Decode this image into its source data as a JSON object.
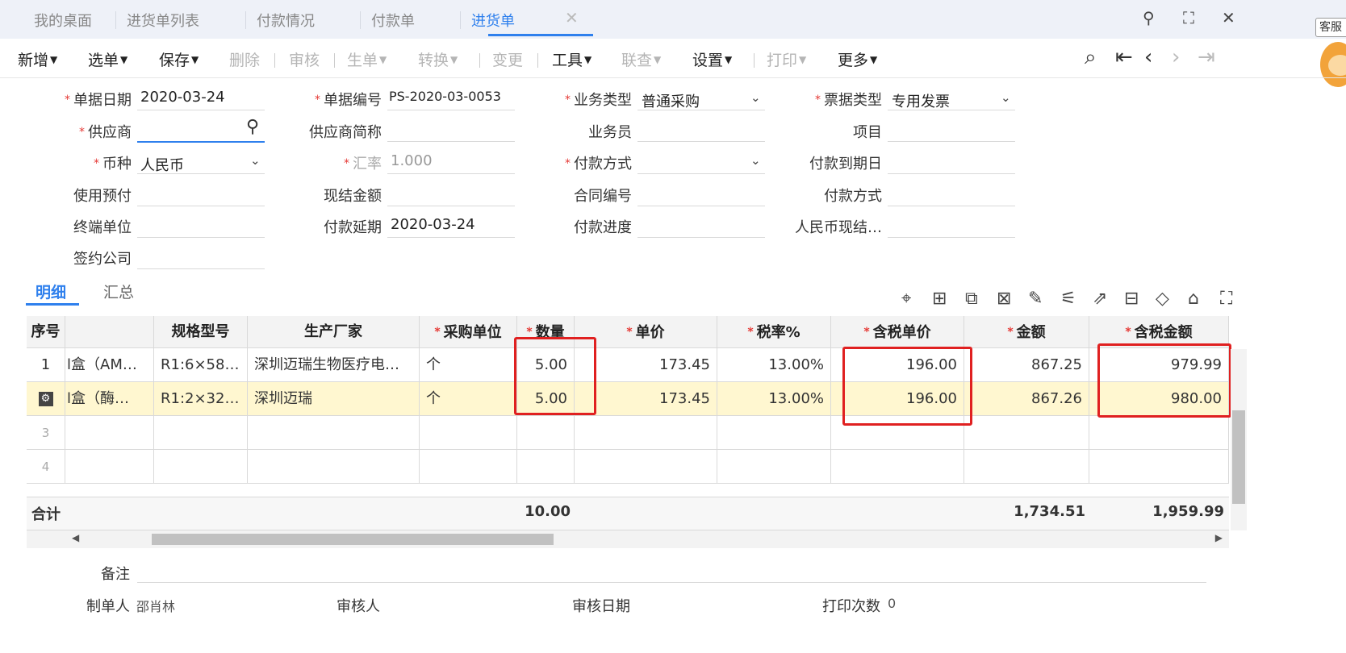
{
  "tabs": {
    "items": [
      {
        "label": "我的桌面"
      },
      {
        "label": "进货单列表"
      },
      {
        "label": "付款情况"
      },
      {
        "label": "付款单"
      },
      {
        "label": "进货单"
      }
    ],
    "close": "✕",
    "kefu": "客服"
  },
  "toolbar": {
    "add": "新增",
    "select": "选单",
    "save": "保存",
    "delete": "删除",
    "audit": "审核",
    "generate": "生单",
    "convert": "转换",
    "change": "变更",
    "tools": "工具",
    "query": "联查",
    "settings": "设置",
    "print": "打印",
    "more": "更多"
  },
  "form": {
    "doc_date_label": "单据日期",
    "doc_date": "2020-03-24",
    "doc_no_label": "单据编号",
    "doc_no": "PS-2020-03-0053",
    "biz_type_label": "业务类型",
    "biz_type": "普通采购",
    "invoice_type_label": "票据类型",
    "invoice_type": "专用发票",
    "supplier_label": "供应商",
    "supplier": "",
    "supplier_short_label": "供应商简称",
    "salesman_label": "业务员",
    "project_label": "项目",
    "currency_label": "币种",
    "currency": "人民币",
    "rate_label": "汇率",
    "rate": "1.000",
    "pay_method_label": "付款方式",
    "pay_due_label": "付款到期日",
    "use_prepay_label": "使用预付",
    "cash_amount_label": "现结金额",
    "contract_no_label": "合同编号",
    "pay_method2_label": "付款方式",
    "terminal_label": "终端单位",
    "pay_delay_label": "付款延期",
    "pay_delay": "2020-03-24",
    "pay_progress_label": "付款进度",
    "rmb_cash_label": "人民币现结…",
    "sign_company_label": "签约公司"
  },
  "detail_tabs": {
    "detail": "明细",
    "summary": "汇总"
  },
  "grid": {
    "headers": {
      "seq": "序号",
      "spec": "规格型号",
      "maker": "生产厂家",
      "unit": "采购单位",
      "qty": "数量",
      "price": "单价",
      "tax_rate": "税率%",
      "tax_price": "含税单价",
      "amount": "金额",
      "tax_amount": "含税金额"
    },
    "rows": [
      {
        "seq": "1",
        "name": "l盒（AM…",
        "spec": "R1:6×58…",
        "maker": "深圳迈瑞生物医疗电…",
        "unit": "个",
        "qty": "5.00",
        "price": "173.45",
        "tax_rate": "13.00%",
        "tax_price": "196.00",
        "amount": "867.25",
        "tax_amount": "979.99"
      },
      {
        "seq": "",
        "name": "l盒（酶…",
        "spec": "R1:2×32…",
        "maker": "深圳迈瑞",
        "unit": "个",
        "qty": "5.00",
        "price": "173.45",
        "tax_rate": "13.00%",
        "tax_price": "196.00",
        "amount": "867.26",
        "tax_amount": "980.00"
      },
      {
        "seq": "3"
      },
      {
        "seq": "4"
      }
    ],
    "total": {
      "label": "合计",
      "qty": "10.00",
      "amount": "1,734.51",
      "tax_amount": "1,959.99"
    }
  },
  "bottom": {
    "remark_label": "备注",
    "maker_label": "制单人",
    "maker": "邵肖林",
    "auditor_label": "审核人",
    "audit_date_label": "审核日期",
    "print_count_label": "打印次数",
    "print_count": "0"
  },
  "colors": {
    "accent": "#2f80ed",
    "required": "#e53935",
    "highlight": "#e02020",
    "selected_row": "#fff7d0"
  }
}
